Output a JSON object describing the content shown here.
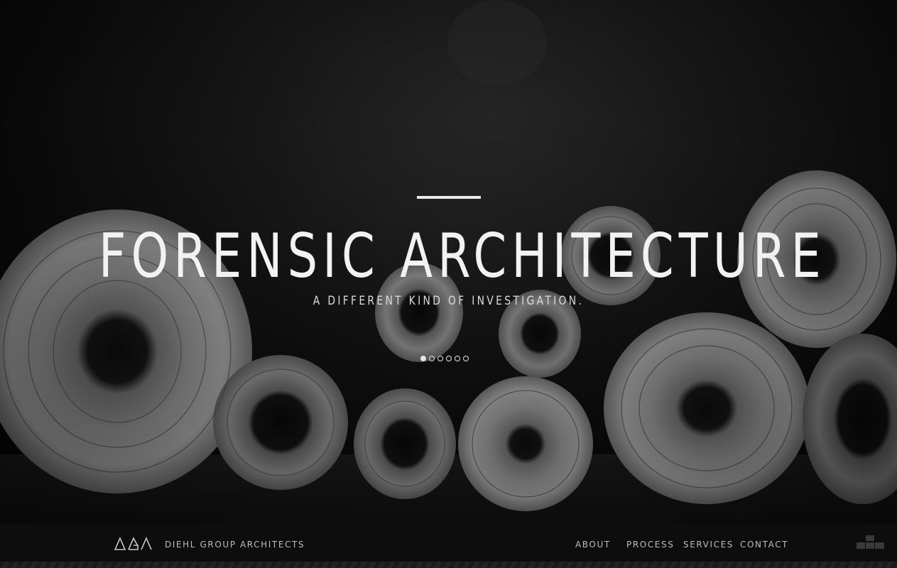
{
  "hero": {
    "title": "FORENSIC ARCHITECTURE",
    "subtitle": "A DIFFERENT KIND OF INVESTIGATION.",
    "slides": {
      "count": 6,
      "active_index": 0
    },
    "background_image": "rolled-blueprints-photo"
  },
  "navbar": {
    "logo_icon": "dga-triangles-logo-icon",
    "brand_name": "DIEHL GROUP ARCHITECTS",
    "links": [
      {
        "label": "ABOUT"
      },
      {
        "label": "PROCESS"
      },
      {
        "label": "SERVICES"
      },
      {
        "label": "CONTACT"
      }
    ],
    "menu_icon": "stacked-blocks-icon"
  },
  "colors": {
    "background": "#080808",
    "text_primary": "#f2f2f2",
    "text_nav": "#bdbdbd",
    "navbar_bg": "#0e0e0e"
  }
}
